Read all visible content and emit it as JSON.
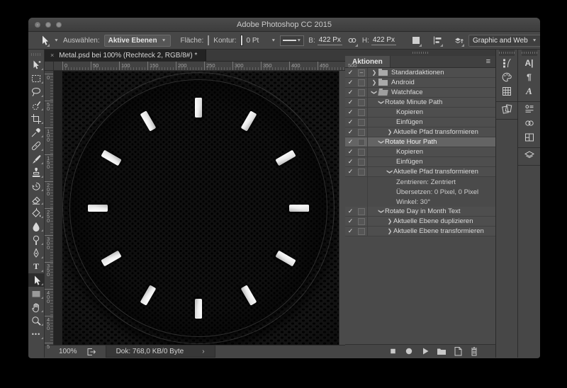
{
  "window": {
    "title": "Adobe Photoshop CC 2015"
  },
  "options_bar": {
    "current_tool": "path-selection",
    "select_label": "Auswählen:",
    "select_value": "Aktive Ebenen",
    "fill_label": "Fläche:",
    "stroke_label": "Kontur:",
    "stroke_width": "0 Pt",
    "width_label": "B:",
    "width_value": "422 Px",
    "height_label": "H:",
    "height_value": "422 Px",
    "workspace": "Graphic and Web",
    "overflow": "»"
  },
  "toolbar": {
    "tools": [
      {
        "name": "move"
      },
      {
        "name": "rectangular-marquee"
      },
      {
        "name": "lasso"
      },
      {
        "name": "quick-selection"
      },
      {
        "name": "crop"
      },
      {
        "name": "eyedropper"
      },
      {
        "name": "spot-healing-brush"
      },
      {
        "name": "brush"
      },
      {
        "name": "clone-stamp"
      },
      {
        "name": "history-brush"
      },
      {
        "name": "eraser"
      },
      {
        "name": "paint-bucket"
      },
      {
        "name": "blur"
      },
      {
        "name": "dodge"
      },
      {
        "name": "pen"
      },
      {
        "name": "type",
        "glyph": "T"
      },
      {
        "name": "path-selection",
        "selected": true
      },
      {
        "name": "rectangle"
      },
      {
        "name": "hand"
      },
      {
        "name": "zoom"
      },
      {
        "name": "more-tools",
        "glyph": "•••"
      }
    ]
  },
  "document": {
    "tab_title": "Metal.psd bei 100% (Rechteck 2, RGB/8#) *",
    "tab_close": "×",
    "zoom_level": "100%",
    "doc_size": "Dok: 768,0 KB/0 Byte",
    "status_chevron": "›",
    "ruler_horizontal": [
      "0",
      "50",
      "100",
      "150",
      "200",
      "250",
      "300",
      "350",
      "400",
      "450",
      "500"
    ],
    "ruler_vertical": [
      "0",
      "50",
      "100",
      "150",
      "200",
      "250",
      "300",
      "350",
      "400",
      "450",
      "5"
    ],
    "watchface": {
      "tick_count": 12
    }
  },
  "actions_panel": {
    "title": "Aktionen",
    "menu_icon": "≡",
    "rows": [
      {
        "label": "Standardaktionen",
        "level": 0,
        "checked": true,
        "modal": "dash",
        "disclosure": "closed",
        "icon": "folder-closed"
      },
      {
        "label": "Android",
        "level": 0,
        "checked": true,
        "modal": "empty",
        "disclosure": "closed",
        "icon": "folder-closed"
      },
      {
        "label": "Watchface",
        "level": 0,
        "checked": true,
        "modal": "empty",
        "disclosure": "open",
        "icon": "folder-open"
      },
      {
        "label": "Rotate Minute Path",
        "level": 1,
        "checked": true,
        "modal": "empty",
        "disclosure": "open"
      },
      {
        "label": "Kopieren",
        "level": 2,
        "checked": true,
        "modal": "empty"
      },
      {
        "label": "Einfügen",
        "level": 2,
        "checked": true,
        "modal": "empty"
      },
      {
        "label": "Aktuelle Pfad transformieren",
        "level": 2,
        "checked": true,
        "modal": "empty",
        "disclosure": "closed"
      },
      {
        "label": "Rotate Hour Path",
        "level": 1,
        "checked": true,
        "modal": "empty",
        "disclosure": "open",
        "selected": true
      },
      {
        "label": "Kopieren",
        "level": 2,
        "checked": true,
        "modal": "empty"
      },
      {
        "label": "Einfügen",
        "level": 2,
        "checked": true,
        "modal": "empty"
      },
      {
        "label": "Aktuelle Pfad transformieren",
        "level": 2,
        "checked": true,
        "modal": "empty",
        "disclosure": "open"
      },
      {
        "label": "Zentrieren: Zentriert",
        "level": 2,
        "detail": true
      },
      {
        "label": "Übersetzen: 0 Pixel, 0 Pixel",
        "level": 2,
        "detail": true
      },
      {
        "label": "Winkel: 30°",
        "level": 2,
        "detail": true
      },
      {
        "label": "Rotate Day in Month Text",
        "level": 1,
        "checked": true,
        "modal": "empty",
        "disclosure": "open"
      },
      {
        "label": "Aktuelle Ebene duplizieren",
        "level": 2,
        "checked": true,
        "modal": "empty",
        "disclosure": "closed"
      },
      {
        "label": "Aktuelle Ebene transformieren",
        "level": 2,
        "checked": true,
        "modal": "empty",
        "disclosure": "closed"
      }
    ],
    "footer_buttons": [
      "stop",
      "record",
      "play",
      "new-folder",
      "new-action",
      "delete"
    ]
  },
  "right_rail": {
    "strip1": [
      [
        "brush-presets",
        "color",
        "swatches"
      ],
      [
        "clone-source"
      ]
    ],
    "strip2": [
      [
        "character",
        "paragraph",
        "glyphs"
      ],
      [
        "libraries",
        "creative-cloud",
        "layer-comps"
      ],
      [
        "layers"
      ]
    ]
  }
}
